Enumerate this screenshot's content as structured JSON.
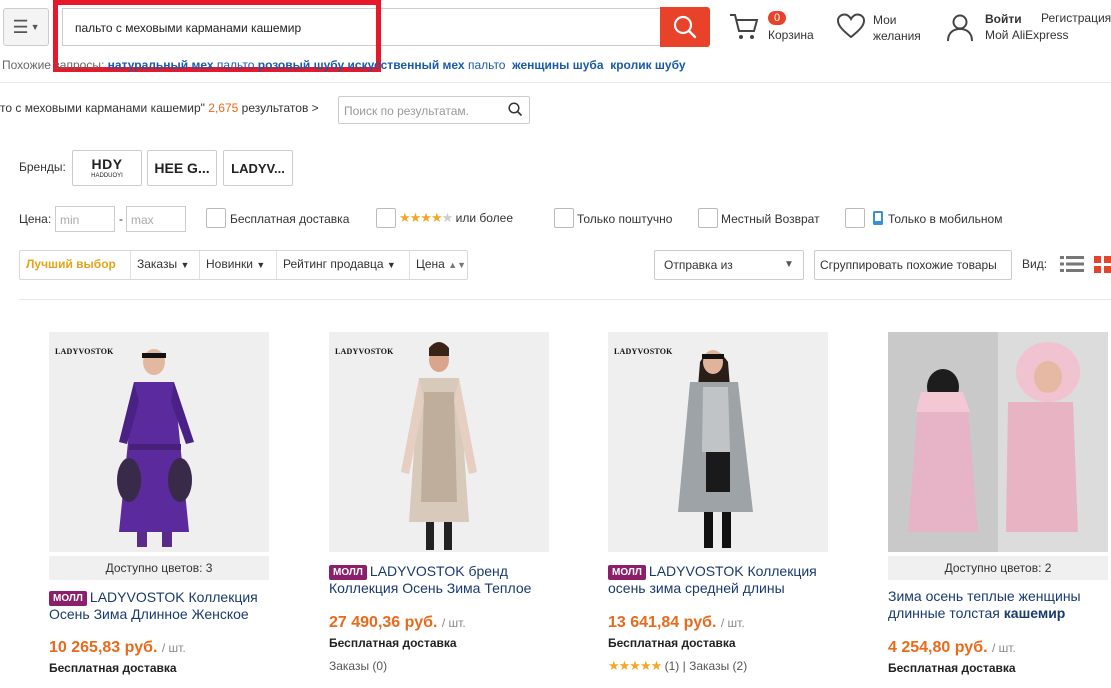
{
  "header": {
    "search_value": "пальто с меховыми карманами кашемир",
    "cart_count": "0",
    "cart_label": "Корзина",
    "wish_line1": "Мои",
    "wish_line2": "желания",
    "login_label": "Войти",
    "register_label": "Регистрация",
    "my_account_label": "Мой AliExpress",
    "accent_color": "#e8432a"
  },
  "related": {
    "prefix": "Похожие запросы:",
    "items": [
      {
        "label": "натуральный мех",
        "style": "bold"
      },
      {
        "label": "пальто",
        "style": "normal"
      },
      {
        "label": "розовый шубу",
        "style": "bold"
      },
      {
        "label": "искусственный мех",
        "style": "bold"
      },
      {
        "label": "пальто",
        "style": "normal"
      },
      {
        "label": "женщины шуба",
        "style": "bold"
      },
      {
        "label": "кролик шубу",
        "style": "bold"
      }
    ]
  },
  "results": {
    "query_text": "то с меховыми карманами кашемир\"",
    "count": "2,675",
    "suffix": "результатов >",
    "within_placeholder": "Поиск по результатам."
  },
  "filters": {
    "brands_label": "Бренды:",
    "brands": [
      {
        "name": "HDY",
        "sub": "HADDUOYI"
      },
      {
        "name": "HEE G..."
      },
      {
        "name": "LADYV..."
      }
    ],
    "price_label": "Цена:",
    "min_placeholder": "min",
    "max_placeholder": "max",
    "free_shipping": "Бесплатная доставка",
    "rating_suffix": "или более",
    "single_item": "Только поштучно",
    "local_return": "Местный Возврат",
    "mobile_only": "Только в мобильном"
  },
  "sort": {
    "best": "Лучший выбор",
    "orders": "Заказы",
    "newest": "Новинки",
    "seller_rating": "Рейтинг продавца",
    "price": "Цена",
    "ship_from": "Отправка из",
    "group_similar": "Сгруппировать похожие товары",
    "view_label": "Вид:"
  },
  "products": [
    {
      "brand_tag": "LADYVOSTOK",
      "colors": "Доступно цветов: 3",
      "mall": "МОЛЛ",
      "title_line1": "LADYVOSTOK Коллекция",
      "title_line2": "Осень Зима Длинное Женское",
      "price": "10 265,83 руб.",
      "unit": "/ шт.",
      "shipping": "Бесплатная доставка"
    },
    {
      "brand_tag": "LADYVOSTOK",
      "mall": "МОЛЛ",
      "title_line1": "LADYVOSTOK бренд",
      "title_line2": "Коллекция Осень Зима Теплое",
      "price": "27 490,36 руб.",
      "unit": "/ шт.",
      "shipping": "Бесплатная доставка",
      "orders": "Заказы (0)"
    },
    {
      "brand_tag": "LADYVOSTOK",
      "mall": "МОЛЛ",
      "title_line1": "LADYVOSTOK Коллекция",
      "title_line2": "осень зима средней длины",
      "price": "13 641,84 руб.",
      "unit": "/ шт.",
      "shipping": "Бесплатная доставка",
      "rating_count": "(1)",
      "orders": "Заказы (2)",
      "rating": 5
    },
    {
      "colors": "Доступно цветов: 2",
      "title_line1": "Зима осень теплые женщины",
      "title_line2_plain": "длинные толстая",
      "title_line2_bold": "кашемир",
      "price": "4 254,80 руб.",
      "unit": "/ шт.",
      "shipping": "Бесплатная доставка"
    }
  ]
}
